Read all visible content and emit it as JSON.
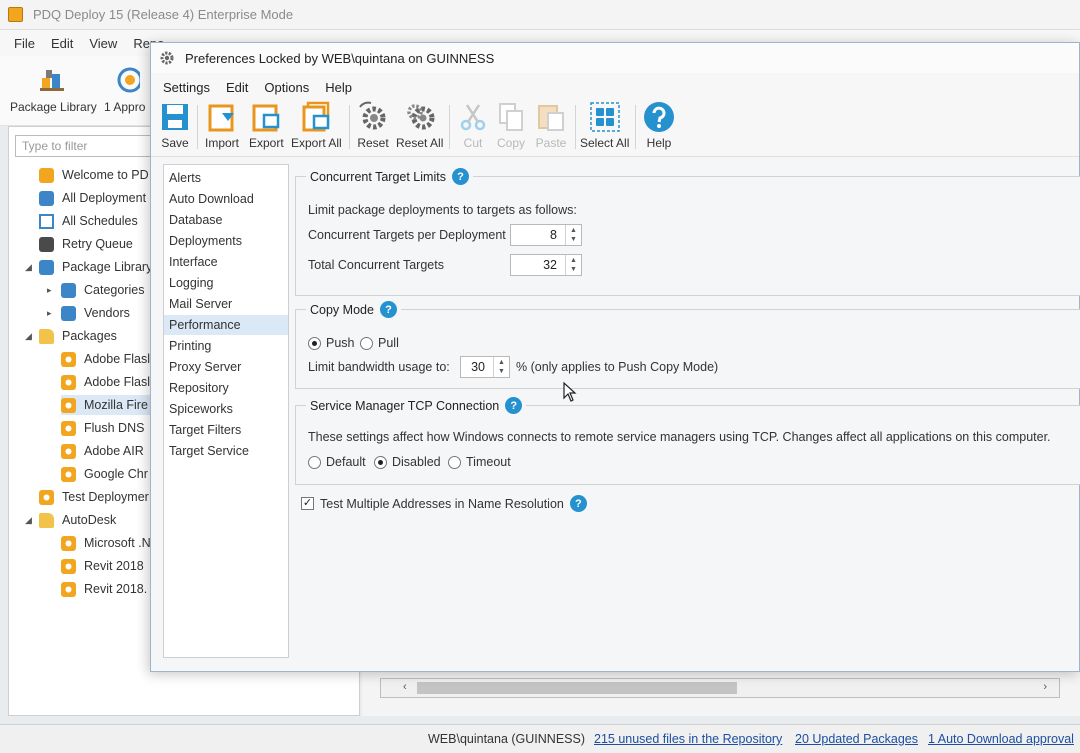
{
  "main_window": {
    "title": "PDQ Deploy 15 (Release 4) Enterprise Mode",
    "menu": [
      "File",
      "Edit",
      "View",
      "Repo"
    ],
    "toolbar": {
      "package_library": "Package Library",
      "approvals": "1 Appro"
    },
    "filter_placeholder": "Type to filter",
    "tree": [
      {
        "label": "Welcome to PD",
        "icon": "welcome-icon"
      },
      {
        "label": "All Deployment",
        "icon": "deployment-icon"
      },
      {
        "label": "All Schedules",
        "icon": "calendar-icon"
      },
      {
        "label": "Retry Queue",
        "icon": "retry-icon"
      },
      {
        "label": "Package Library",
        "icon": "library-icon"
      },
      {
        "label": "Categories",
        "icon": "cloud-icon"
      },
      {
        "label": "Vendors",
        "icon": "vendor-icon"
      },
      {
        "label": "Packages",
        "icon": "folder-icon"
      },
      {
        "label": "Adobe Flasl",
        "icon": "package-icon"
      },
      {
        "label": "Adobe Flasl",
        "icon": "package-icon"
      },
      {
        "label": "Mozilla Fire",
        "icon": "package-icon"
      },
      {
        "label": "Flush DNS",
        "icon": "package-icon"
      },
      {
        "label": "Adobe AIR",
        "icon": "package-icon"
      },
      {
        "label": "Google Chr",
        "icon": "package-icon"
      },
      {
        "label": "Test Deploymer",
        "icon": "package-icon"
      },
      {
        "label": "AutoDesk",
        "icon": "folder-icon"
      },
      {
        "label": "Microsoft .N",
        "icon": "package-icon"
      },
      {
        "label": "Revit 2018",
        "icon": "package-icon"
      },
      {
        "label": "Revit 2018.",
        "icon": "package-icon"
      }
    ],
    "status": {
      "user": "WEB\\quintana  (GUINNESS)",
      "unused_files": "215 unused files in the Repository",
      "updated_packages": "20 Updated Packages",
      "auto_download": "1 Auto Download approval"
    }
  },
  "dialog": {
    "title": "Preferences Locked by WEB\\quintana on GUINNESS",
    "menu": [
      "Settings",
      "Edit",
      "Options",
      "Help"
    ],
    "toolbar": {
      "save": "Save",
      "import": "Import",
      "export": "Export",
      "export_all": "Export All",
      "reset": "Reset",
      "reset_all": "Reset All",
      "cut": "Cut",
      "copy": "Copy",
      "paste": "Paste",
      "select_all": "Select All",
      "help": "Help"
    },
    "categories": [
      "Alerts",
      "Auto Download",
      "Database",
      "Deployments",
      "Interface",
      "Logging",
      "Mail Server",
      "Performance",
      "Printing",
      "Proxy Server",
      "Repository",
      "Spiceworks",
      "Target Filters",
      "Target Service"
    ],
    "selected_category": "Performance",
    "concurrent": {
      "title": "Concurrent Target Limits",
      "description": "Limit package deployments to targets as follows:",
      "per_deployment_label": "Concurrent Targets per Deployment",
      "per_deployment_value": "8",
      "total_label": "Total Concurrent Targets",
      "total_value": "32"
    },
    "copy_mode": {
      "title": "Copy Mode",
      "push": "Push",
      "pull": "Pull",
      "selected": "Push",
      "bandwidth_label": "Limit bandwidth usage to:",
      "bandwidth_value": "30",
      "bandwidth_suffix": "% (only applies to Push Copy Mode)"
    },
    "service_manager": {
      "title": "Service Manager TCP Connection",
      "description": "These settings affect how Windows connects to remote service managers using TCP. Changes affect all applications on this computer.",
      "default": "Default",
      "disabled": "Disabled",
      "timeout": "Timeout",
      "selected": "Disabled"
    },
    "name_resolution": {
      "label": "Test Multiple Addresses in Name Resolution",
      "checked": true,
      "check_mark": "✓"
    },
    "help_glyph": "?"
  },
  "colors": {
    "accent_blue": "#2691cf",
    "link": "#1d4ea0",
    "selection": "#dbe8f5",
    "icon_orange": "#f2a51f"
  }
}
